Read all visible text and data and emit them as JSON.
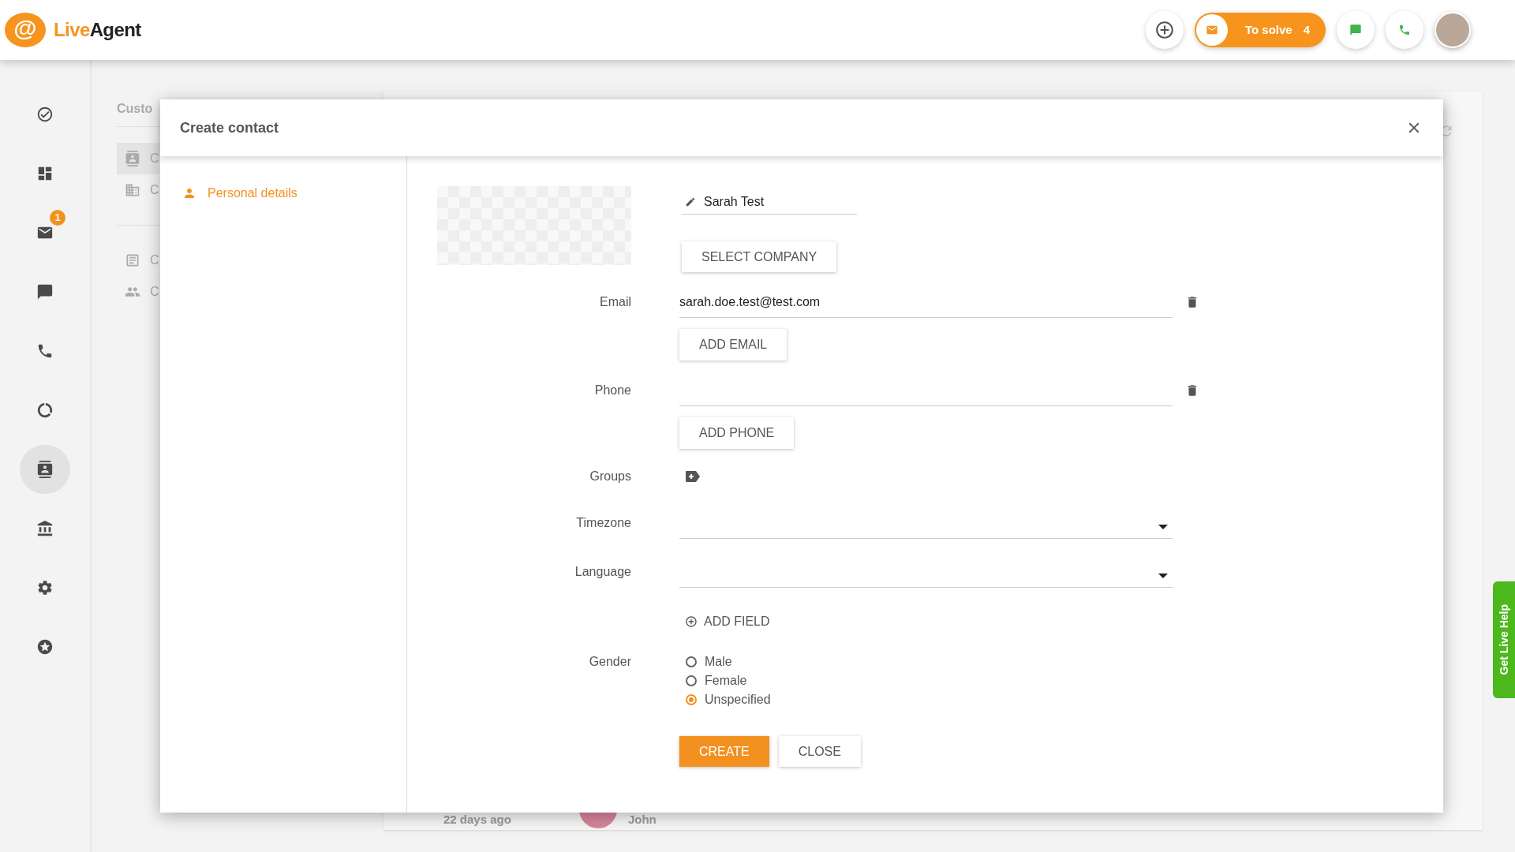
{
  "header": {
    "logo": {
      "mark": "@",
      "first": "Live",
      "second": "Agent"
    },
    "to_solve": {
      "label": "To solve",
      "count": "4"
    }
  },
  "sidebar": {
    "items": [
      {
        "selected": false
      },
      {
        "selected": false
      },
      {
        "selected": false,
        "badge": "1"
      },
      {
        "selected": false
      },
      {
        "selected": false
      },
      {
        "selected": false
      },
      {
        "selected": true
      },
      {
        "selected": false
      },
      {
        "selected": false
      },
      {
        "selected": false
      }
    ]
  },
  "background": {
    "title": "Custo",
    "items": [
      {
        "label": "C",
        "selected": true
      },
      {
        "label": "C",
        "selected": false
      },
      {
        "label": "C",
        "selected": false
      },
      {
        "label": "C",
        "selected": false
      }
    ],
    "row": {
      "time": "22 days ago",
      "name": "John"
    }
  },
  "modal": {
    "title": "Create contact",
    "nav": [
      {
        "label": "Personal details",
        "selected": true
      }
    ],
    "name": "Sarah Test",
    "select_company": "SELECT COMPANY",
    "rows": [
      {
        "kind": "multi",
        "label": "Email",
        "value": "sarah.doe.test@test.com",
        "add": "ADD EMAIL"
      },
      {
        "kind": "multi",
        "label": "Phone",
        "add": "ADD PHONE"
      },
      {
        "kind": "groups",
        "label": "Groups"
      },
      {
        "kind": "select",
        "label": "Timezone"
      },
      {
        "kind": "select",
        "label": "Language"
      },
      {
        "kind": "add",
        "text": "ADD FIELD"
      },
      {
        "kind": "radio",
        "label": "Gender",
        "options": [
          {
            "label": "Male",
            "selected": false
          },
          {
            "label": "Female",
            "selected": false
          },
          {
            "label": "Unspecified",
            "selected": true
          }
        ]
      }
    ],
    "buttons": [
      {
        "label": "CREATE",
        "primary": true
      },
      {
        "label": "CLOSE",
        "primary": false
      }
    ]
  },
  "live_help": "Get Live Help"
}
